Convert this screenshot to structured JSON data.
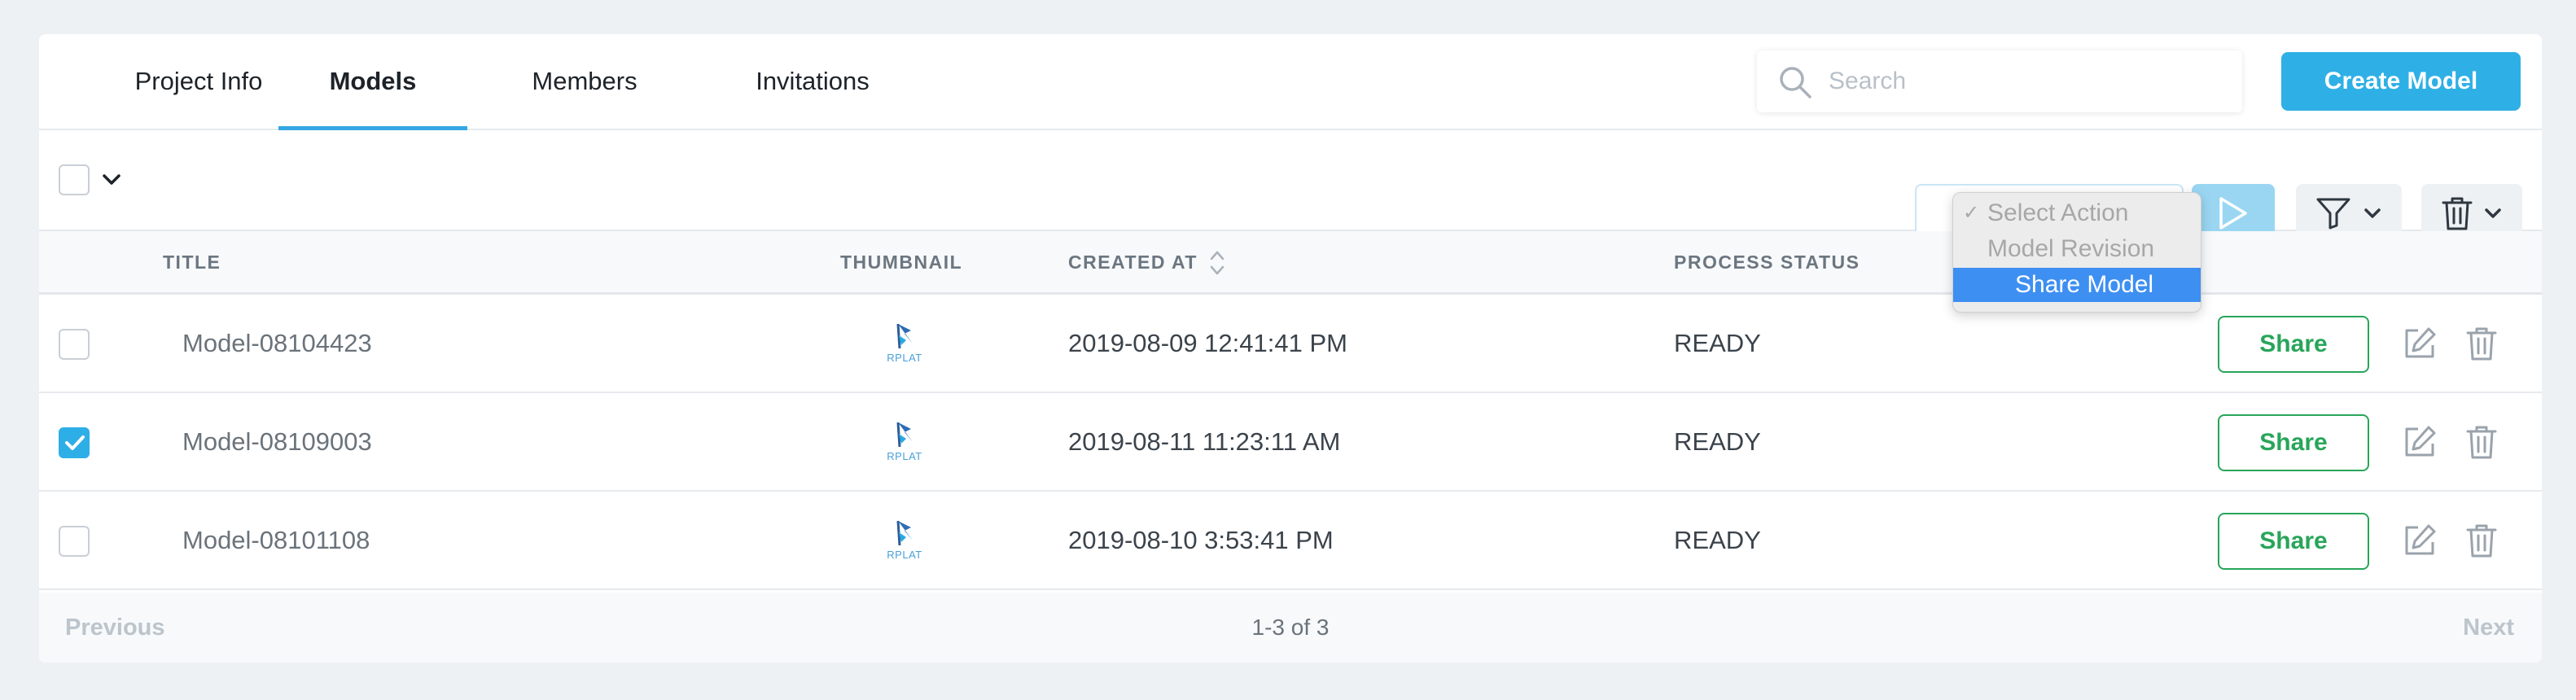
{
  "tabs": [
    {
      "label": "Project Info"
    },
    {
      "label": "Models"
    },
    {
      "label": "Members"
    },
    {
      "label": "Invitations"
    }
  ],
  "active_tab": "Models",
  "search": {
    "placeholder": "Search",
    "value": ""
  },
  "create_button": "Create Model",
  "action_select": {
    "options": [
      {
        "label": "Select Action",
        "checked": true
      },
      {
        "label": "Model Revision"
      },
      {
        "label": "Share Model",
        "highlighted": true
      }
    ]
  },
  "table": {
    "columns": [
      "TITLE",
      "THUMBNAIL",
      "CREATED AT",
      "PROCESS STATUS"
    ],
    "rows": [
      {
        "title": "Model-08104423",
        "thumbnail_label": "RPLAT",
        "created_at": "2019-08-09 12:41:41 PM",
        "status": "READY",
        "share": "Share",
        "checked": false
      },
      {
        "title": "Model-08109003",
        "thumbnail_label": "RPLAT",
        "created_at": "2019-08-11 11:23:11 AM",
        "status": "READY",
        "share": "Share",
        "checked": true
      },
      {
        "title": "Model-08101108",
        "thumbnail_label": "RPLAT",
        "created_at": "2019-08-10 3:53:41 PM",
        "status": "READY",
        "share": "Share",
        "checked": false
      }
    ]
  },
  "pagination": {
    "previous": "Previous",
    "range": "1-3 of 3",
    "next": "Next"
  },
  "icons": {
    "search": "search-icon",
    "run": "play-icon",
    "filter": "filter-icon",
    "trash": "trash-icon",
    "edit": "edit-icon",
    "sort": "sort-icon",
    "chevron": "chevron-down-icon",
    "thumbnail": "flag-logo-icon"
  },
  "colors": {
    "accent": "#2eb0e6",
    "share": "#28a55a",
    "selected_option": "#3d8ff2"
  }
}
